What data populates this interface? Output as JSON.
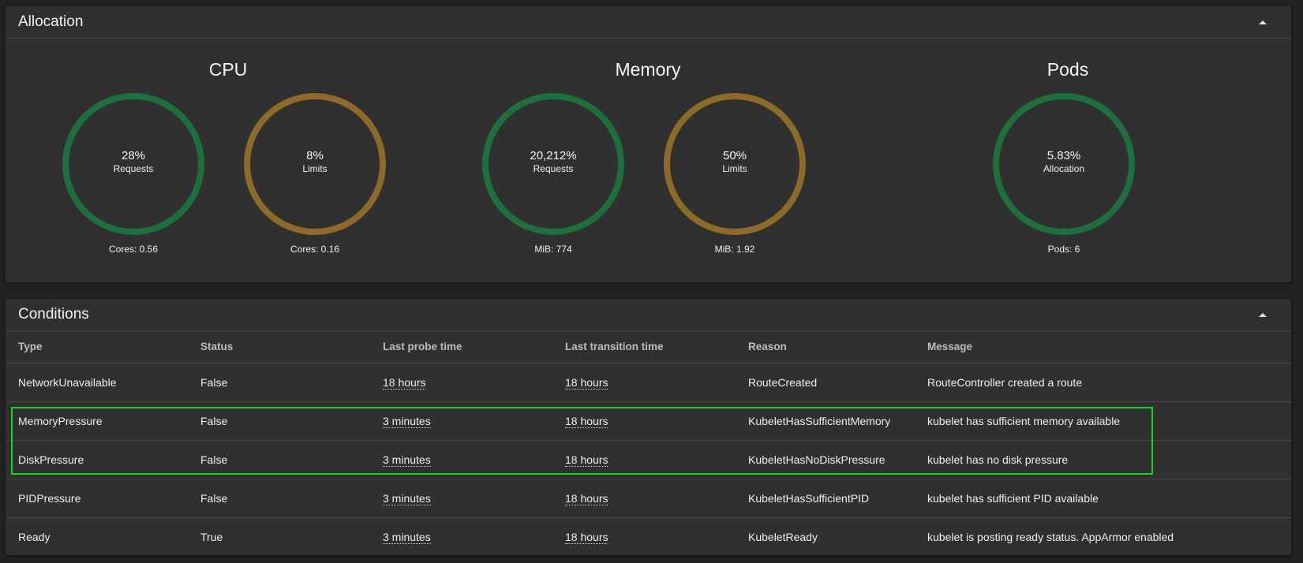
{
  "allocation": {
    "title": "Allocation",
    "colors": {
      "requests": "#1e6e3e",
      "limits": "#8c6a2a",
      "track": "#303030"
    },
    "groups": [
      {
        "name": "CPU",
        "gauges": [
          {
            "value": "28%",
            "label": "Requests",
            "sub": "Cores: 0.56",
            "kind": "requests"
          },
          {
            "value": "8%",
            "label": "Limits",
            "sub": "Cores: 0.16",
            "kind": "limits"
          }
        ]
      },
      {
        "name": "Memory",
        "gauges": [
          {
            "value": "20,212%",
            "label": "Requests",
            "sub": "MiB: 774",
            "kind": "requests"
          },
          {
            "value": "50%",
            "label": "Limits",
            "sub": "MiB: 1.92",
            "kind": "limits"
          }
        ]
      },
      {
        "name": "Pods",
        "gauges": [
          {
            "value": "5.83%",
            "label": "Allocation",
            "sub": "Pods: 6",
            "kind": "requests"
          }
        ]
      }
    ]
  },
  "conditions": {
    "title": "Conditions",
    "columns": [
      "Type",
      "Status",
      "Last probe time",
      "Last transition time",
      "Reason",
      "Message"
    ],
    "rows": [
      {
        "type": "NetworkUnavailable",
        "status": "False",
        "probe": "18 hours",
        "transition": "18 hours",
        "reason": "RouteCreated",
        "message": "RouteController created a route"
      },
      {
        "type": "MemoryPressure",
        "status": "False",
        "probe": "3 minutes",
        "transition": "18 hours",
        "reason": "KubeletHasSufficientMemory",
        "message": "kubelet has sufficient memory available"
      },
      {
        "type": "DiskPressure",
        "status": "False",
        "probe": "3 minutes",
        "transition": "18 hours",
        "reason": "KubeletHasNoDiskPressure",
        "message": "kubelet has no disk pressure"
      },
      {
        "type": "PIDPressure",
        "status": "False",
        "probe": "3 minutes",
        "transition": "18 hours",
        "reason": "KubeletHasSufficientPID",
        "message": "kubelet has sufficient PID available"
      },
      {
        "type": "Ready",
        "status": "True",
        "probe": "3 minutes",
        "transition": "18 hours",
        "reason": "KubeletReady",
        "message": "kubelet is posting ready status. AppArmor enabled"
      }
    ]
  },
  "icons": {
    "collapse": "chevron-up-icon"
  }
}
